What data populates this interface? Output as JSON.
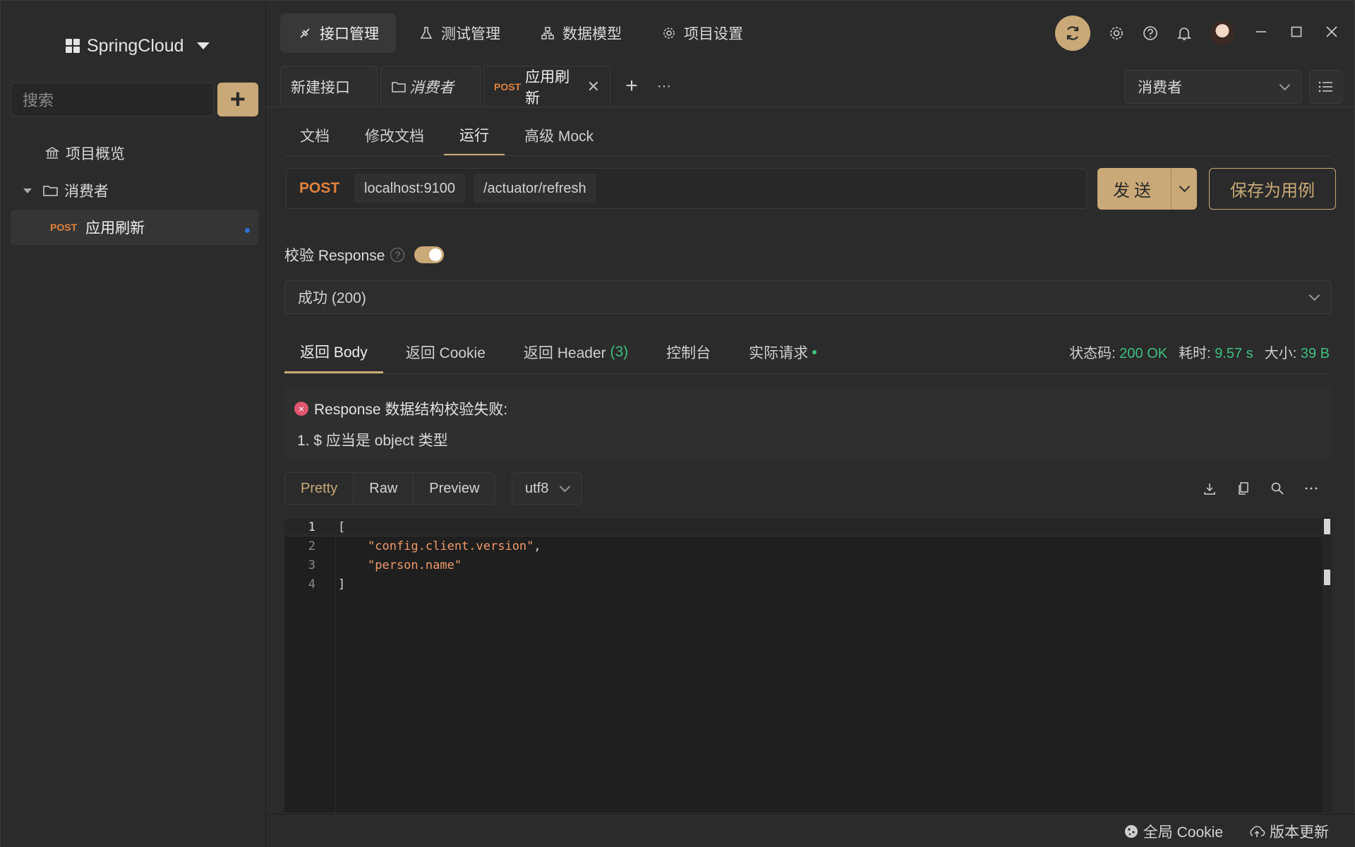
{
  "sidebar": {
    "project_name": "SpringCloud",
    "search_placeholder": "搜索",
    "add_label": "+",
    "items": [
      {
        "label": "项目概览",
        "icon": "bank-icon"
      },
      {
        "label": "消费者",
        "icon": "folder-icon"
      },
      {
        "method": "POST",
        "label": "应用刷新"
      }
    ]
  },
  "topnav": {
    "items": [
      {
        "label": "接口管理",
        "icon": "api-icon",
        "active": true
      },
      {
        "label": "测试管理",
        "icon": "flask-icon"
      },
      {
        "label": "数据模型",
        "icon": "sitemap-icon"
      },
      {
        "label": "项目设置",
        "icon": "gear-icon"
      }
    ]
  },
  "tabs": {
    "items": [
      {
        "label": "新建接口"
      },
      {
        "label": "消费者",
        "icon": "folder-icon"
      },
      {
        "method": "POST",
        "label": "应用刷新",
        "close": "✕",
        "active": true
      }
    ],
    "plus": "+",
    "more": "···"
  },
  "env_select": {
    "value": "消费者"
  },
  "subtabs": [
    "文档",
    "修改文档",
    "运行",
    "高级 Mock"
  ],
  "request": {
    "method": "POST",
    "host": "localhost:9100",
    "path": "/actuator/refresh",
    "send_label": "发送",
    "save_label": "保存为用例"
  },
  "validate": {
    "label": "校验 Response",
    "help": "?",
    "enabled": true
  },
  "response_select": {
    "value": "成功 (200)"
  },
  "response_tabs": {
    "body": "返回 Body",
    "cookie": "返回 Cookie",
    "header": "返回 Header",
    "header_count": "(3)",
    "console": "控制台",
    "actual": "实际请求"
  },
  "stats": {
    "status_label": "状态码:",
    "status_value": "200 OK",
    "time_label": "耗时:",
    "time_value": "9.57 s",
    "size_label": "大小:",
    "size_value": "39 B"
  },
  "error": {
    "icon": "×",
    "title": "Response 数据结构校验失败:",
    "item": "1. $ 应当是 object 类型"
  },
  "format": {
    "buttons": [
      "Pretty",
      "Raw",
      "Preview"
    ],
    "encoding": "utf8"
  },
  "code": {
    "line_numbers": [
      "1",
      "2",
      "3",
      "4"
    ],
    "lines": [
      "[",
      "\"config.client.version\"",
      "\"person.name\"",
      "]"
    ],
    "comma": ","
  },
  "statusbar": {
    "cookie_label": "全局 Cookie",
    "update_label": "版本更新"
  },
  "colors": {
    "accent": "#c9a977",
    "post_method": "#e0823c",
    "success": "#3fbf7f",
    "error": "#e0576f"
  }
}
